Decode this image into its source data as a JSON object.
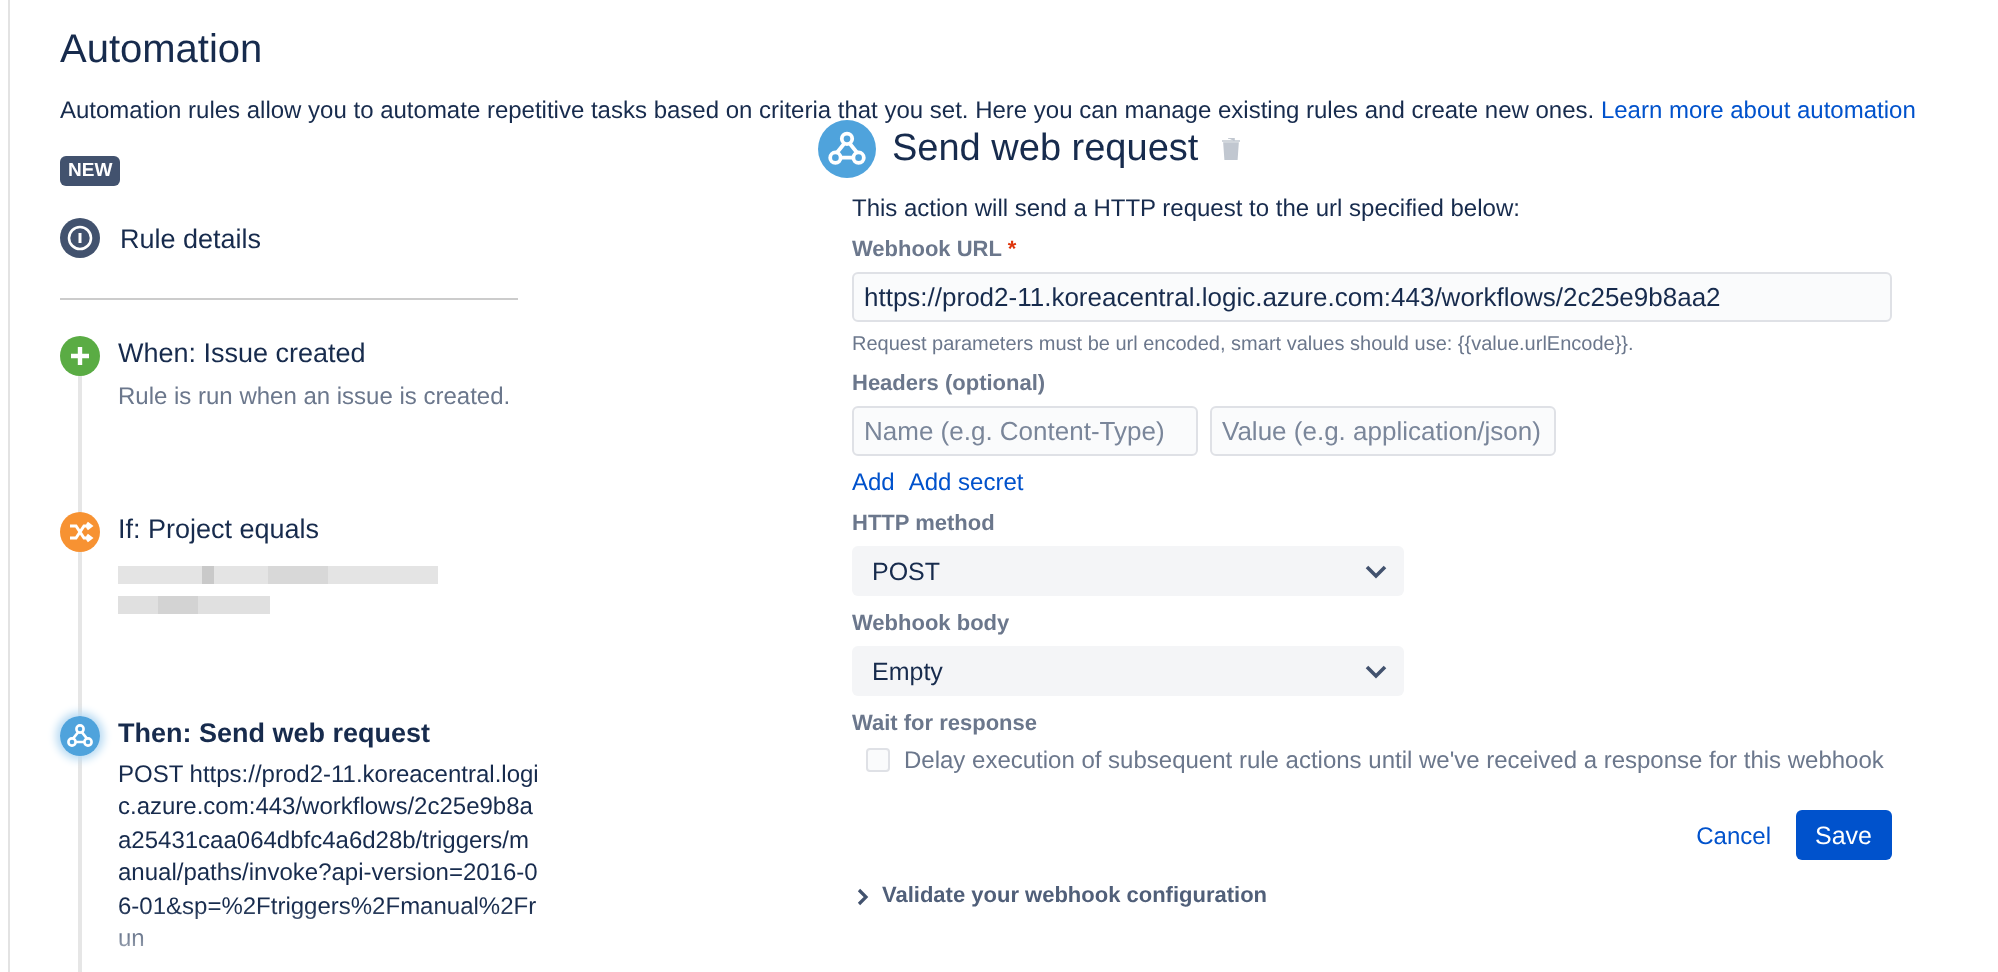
{
  "page": {
    "title": "Automation",
    "description": "Automation rules allow you to automate repetitive tasks based on criteria that you set. Here you can manage existing rules and create new ones.",
    "learn_more": "Learn more about automation"
  },
  "badge": "NEW",
  "rule_details": "Rule details",
  "steps": [
    {
      "kind": "trigger",
      "title": "When: Issue created",
      "description": "Rule is run when an issue is created.",
      "selected": false
    },
    {
      "kind": "condition",
      "title": "If: Project equals",
      "redacted": true,
      "selected": false
    },
    {
      "kind": "action",
      "title": "Then: Send web request",
      "description": "POST https://prod2-11.koreacentral.logic.azure.com:443/workflows/2c25e9b8aa25431caa064dbfc4a6d28b/triggers/manual/paths/invoke?api-version=2016-06-01&sp=%2Ftriggers%2Fmanual%2Frun",
      "selected": true
    }
  ],
  "editor": {
    "title": "Send web request",
    "intro": "This action will send a HTTP request to the url specified below:",
    "url": {
      "label": "Webhook URL",
      "required_mark": "*",
      "value": "https://prod2-11.koreacentral.logic.azure.com:443/workflows/2c25e9b8aa2",
      "help": "Request parameters must be url encoded, smart values should use: {{value.urlEncode}}."
    },
    "headers": {
      "label": "Headers (optional)",
      "name_placeholder": "Name (e.g. Content-Type)",
      "value_placeholder": "Value (e.g. application/json)",
      "links": [
        "Add",
        "Add secret"
      ]
    },
    "method": {
      "label": "HTTP method",
      "value": "POST"
    },
    "body": {
      "label": "Webhook body",
      "value": "Empty"
    },
    "wait": {
      "label": "Wait for response",
      "option": "Delay execution of subsequent rule actions until we've received a response for this webhook",
      "checked": false
    },
    "buttons": {
      "cancel": "Cancel",
      "save": "Save"
    },
    "validate": {
      "label": "Validate your webhook configuration",
      "expanded": false
    }
  }
}
